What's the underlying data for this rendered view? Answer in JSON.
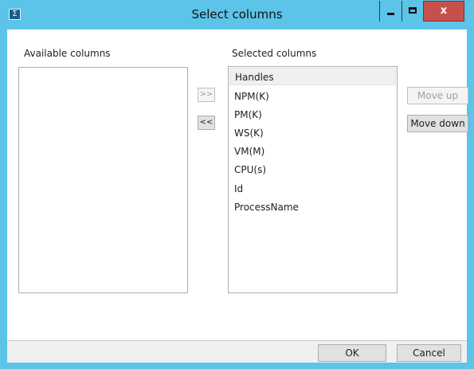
{
  "window": {
    "title": "Select columns",
    "app_icon_glyph": "Σ",
    "controls": {
      "minimize": "minimize-icon",
      "maximize": "maximize-icon",
      "close_glyph": "x"
    },
    "colors": {
      "titlebar": "#5bc4e8",
      "close_button": "#c7514a",
      "selected_row": "#f2efef"
    }
  },
  "available": {
    "label": "Available columns",
    "items": []
  },
  "selected": {
    "label": "Selected columns",
    "items": [
      "Handles",
      "NPM(K)",
      "PM(K)",
      "WS(K)",
      "VM(M)",
      "CPU(s)",
      "Id",
      "ProcessName"
    ],
    "highlighted": "Handles"
  },
  "buttons": {
    "add": ">>",
    "remove": "<<",
    "move_up": "Move up",
    "move_down": "Move down",
    "ok": "OK",
    "cancel": "Cancel"
  }
}
